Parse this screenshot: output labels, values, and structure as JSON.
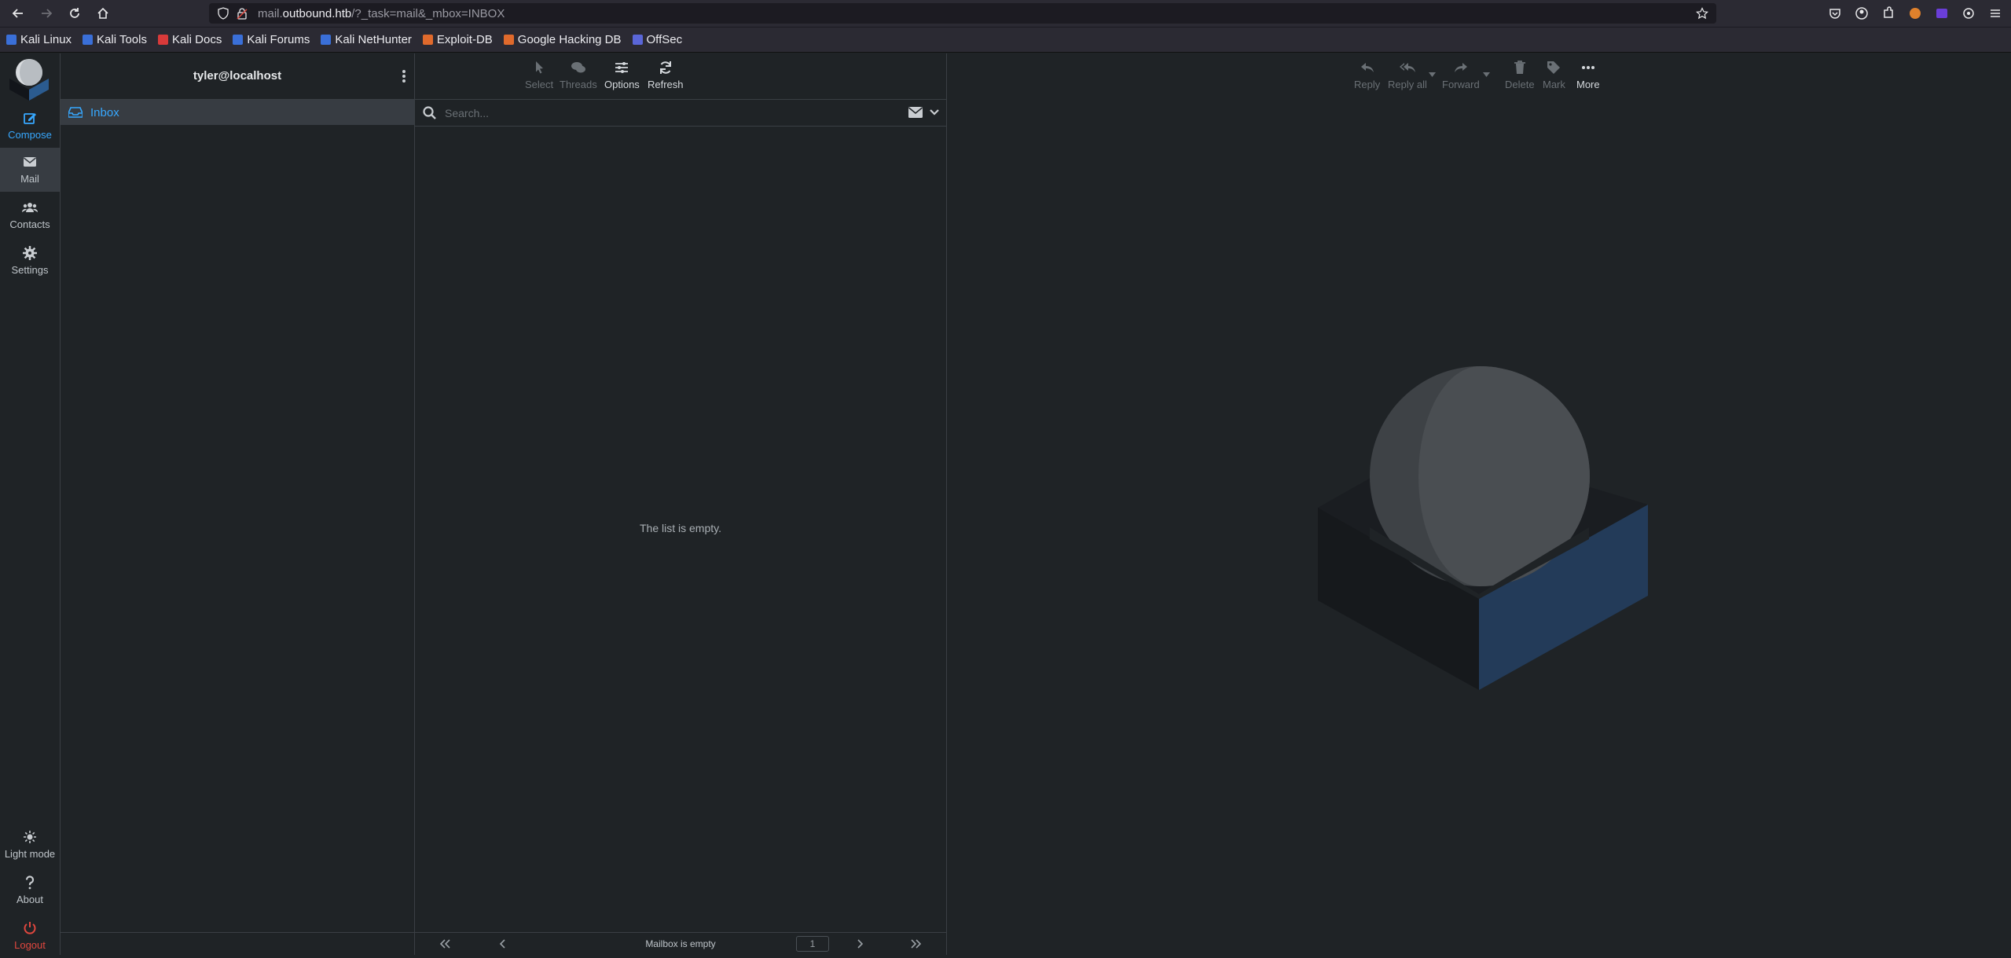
{
  "browser": {
    "url_prefix": "mail.",
    "url_host": "outbound.htb",
    "url_path": "/?_task=mail&_mbox=INBOX",
    "bookmarks": [
      "Kali Linux",
      "Kali Tools",
      "Kali Docs",
      "Kali Forums",
      "Kali NetHunter",
      "Exploit-DB",
      "Google Hacking DB",
      "OffSec"
    ],
    "bookmark_colors": [
      "#3a6fd8",
      "#3a6fd8",
      "#d93a3a",
      "#3a6fd8",
      "#3a6fd8",
      "#e06a2c",
      "#e06a2c",
      "#5a66d8"
    ]
  },
  "rail": {
    "compose": "Compose",
    "mail": "Mail",
    "contacts": "Contacts",
    "settings": "Settings",
    "light_mode": "Light mode",
    "about": "About",
    "logout": "Logout"
  },
  "folders": {
    "account": "tyler@localhost",
    "items": [
      {
        "label": "Inbox"
      }
    ]
  },
  "list_toolbar": {
    "select": "Select",
    "threads": "Threads",
    "options": "Options",
    "refresh": "Refresh"
  },
  "search": {
    "placeholder": "Search..."
  },
  "list": {
    "empty_message": "The list is empty.",
    "footer_status": "Mailbox is empty",
    "page": "1"
  },
  "message_toolbar": {
    "reply": "Reply",
    "reply_all": "Reply all",
    "forward": "Forward",
    "delete": "Delete",
    "mark": "Mark",
    "more": "More"
  },
  "colors": {
    "accent": "#37a8ff",
    "logout": "#e0473e",
    "background": "#1f2326",
    "selected": "#373c42"
  }
}
